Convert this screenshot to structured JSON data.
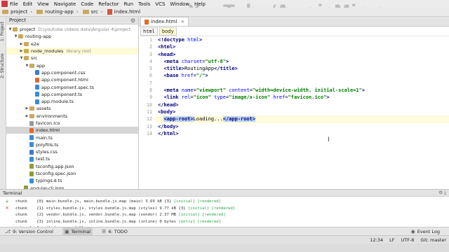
{
  "menubar": {
    "items": [
      "File",
      "Edit",
      "View",
      "Navigate",
      "Code",
      "Refactor",
      "Run",
      "Tools",
      "VCS",
      "Window",
      "Help"
    ]
  },
  "watermark": "YouTube/AwaisMirza",
  "navbar": {
    "crumbs": [
      "project",
      "routing-app",
      "src",
      "index.html"
    ]
  },
  "left_strip": {
    "tabs": [
      "1: Project",
      "2: Structure"
    ]
  },
  "project_panel": {
    "title": "Project",
    "tree": [
      {
        "label": "project",
        "suffix": "D:\\youtube videos data\\Angular 4\\project",
        "depth": 0,
        "kind": "folder",
        "open": true
      },
      {
        "label": "routing-app",
        "depth": 1,
        "kind": "folder",
        "open": true
      },
      {
        "label": "e2e",
        "depth": 2,
        "kind": "folder",
        "open": false
      },
      {
        "label": "node_modules",
        "suffix": "library root",
        "depth": 2,
        "kind": "folder",
        "open": false,
        "highlight": true
      },
      {
        "label": "src",
        "depth": 2,
        "kind": "folder",
        "open": true
      },
      {
        "label": "app",
        "depth": 3,
        "kind": "folder",
        "open": true
      },
      {
        "label": "app.component.css",
        "depth": 4,
        "kind": "css"
      },
      {
        "label": "app.component.html",
        "depth": 4,
        "kind": "html"
      },
      {
        "label": "app.component.spec.ts",
        "depth": 4,
        "kind": "ts"
      },
      {
        "label": "app.component.ts",
        "depth": 4,
        "kind": "ts"
      },
      {
        "label": "app.module.ts",
        "depth": 4,
        "kind": "ts"
      },
      {
        "label": "assets",
        "depth": 3,
        "kind": "folder",
        "open": false
      },
      {
        "label": "environments",
        "depth": 3,
        "kind": "folder",
        "open": false
      },
      {
        "label": "favicon.ico",
        "depth": 3,
        "kind": "ico-file"
      },
      {
        "label": "index.html",
        "depth": 3,
        "kind": "html",
        "selected": true
      },
      {
        "label": "main.ts",
        "depth": 3,
        "kind": "ts"
      },
      {
        "label": "polyfills.ts",
        "depth": 3,
        "kind": "ts"
      },
      {
        "label": "styles.css",
        "depth": 3,
        "kind": "css"
      },
      {
        "label": "test.ts",
        "depth": 3,
        "kind": "ts"
      },
      {
        "label": "tsconfig.app.json",
        "depth": 3,
        "kind": "json"
      },
      {
        "label": "tsconfig.spec.json",
        "depth": 3,
        "kind": "json"
      },
      {
        "label": "typings.d.ts",
        "depth": 3,
        "kind": "ts"
      },
      {
        "label": "angular-cli.json",
        "depth": 2,
        "kind": "json"
      }
    ]
  },
  "editor": {
    "tab": "index.html",
    "breadcrumb": [
      "html",
      "body"
    ],
    "lines": [
      [
        {
          "t": "<!doctype ",
          "c": "kw"
        },
        {
          "t": "html",
          "c": "attr"
        },
        {
          "t": ">",
          "c": "kw"
        }
      ],
      [
        {
          "t": "<html>",
          "c": "kw"
        }
      ],
      [
        {
          "t": "<head>",
          "c": "kw"
        }
      ],
      [
        {
          "t": "  "
        },
        {
          "t": "<meta ",
          "c": "kw"
        },
        {
          "t": "charset",
          "c": "attr"
        },
        {
          "t": "=",
          "c": ""
        },
        {
          "t": "\"utf-8\"",
          "c": "str"
        },
        {
          "t": ">",
          "c": "kw"
        }
      ],
      [
        {
          "t": "  "
        },
        {
          "t": "<title>",
          "c": "kw"
        },
        {
          "t": "RoutingApp"
        },
        {
          "t": "</title>",
          "c": "kw"
        }
      ],
      [
        {
          "t": "  "
        },
        {
          "t": "<base ",
          "c": "kw"
        },
        {
          "t": "href",
          "c": "attr"
        },
        {
          "t": "=",
          "c": ""
        },
        {
          "t": "\"/\"",
          "c": "str"
        },
        {
          "t": ">",
          "c": "kw"
        }
      ],
      [
        {
          "t": ""
        }
      ],
      [
        {
          "t": "  "
        },
        {
          "t": "<meta ",
          "c": "kw"
        },
        {
          "t": "name",
          "c": "attr"
        },
        {
          "t": "="
        },
        {
          "t": "\"viewport\"",
          "c": "str"
        },
        {
          "t": " "
        },
        {
          "t": "content",
          "c": "attr"
        },
        {
          "t": "="
        },
        {
          "t": "\"width=device-width, initial-scale=1\"",
          "c": "str"
        },
        {
          "t": ">",
          "c": "kw"
        }
      ],
      [
        {
          "t": "  "
        },
        {
          "t": "<link ",
          "c": "kw"
        },
        {
          "t": "rel",
          "c": "attr"
        },
        {
          "t": "="
        },
        {
          "t": "\"icon\"",
          "c": "str"
        },
        {
          "t": " "
        },
        {
          "t": "type",
          "c": "attr"
        },
        {
          "t": "="
        },
        {
          "t": "\"image/x-icon\"",
          "c": "str"
        },
        {
          "t": " "
        },
        {
          "t": "href",
          "c": "attr"
        },
        {
          "t": "="
        },
        {
          "t": "\"favicon.ico\"",
          "c": "str"
        },
        {
          "t": ">",
          "c": "kw"
        }
      ],
      [
        {
          "t": "</head>",
          "c": "kw"
        }
      ],
      [
        {
          "t": "<body>",
          "c": "kw"
        }
      ],
      [
        {
          "t": "  "
        },
        {
          "t": "<app-root>",
          "c": "kw sel"
        },
        {
          "t": "Loading..."
        },
        {
          "t": "</app-root>",
          "c": "kw sel"
        }
      ],
      [
        {
          "t": "</body>",
          "c": "kw"
        }
      ],
      [
        {
          "t": "</html>",
          "c": "kw"
        }
      ]
    ],
    "current_line": 12
  },
  "terminal": {
    "title": "Terminal",
    "lines": [
      [
        {
          "t": "chunk    {0} main.bundle.js, main.bundle.js.map (main) 3.69 kB {3} "
        },
        {
          "t": "[initial] [rendered]",
          "c": "g"
        }
      ],
      [
        {
          "t": "chunk    {1} styles.bundle.js, styles.bundle.js.map (styles) 9.77 kB {3} "
        },
        {
          "t": "[initial] [rendered]",
          "c": "g"
        }
      ],
      [
        {
          "t": "chunk    {2} vendor.bundle.js, vendor.bundle.js.map (vendor) 2.37 MB "
        },
        {
          "t": "[initial] [rendered]",
          "c": "g"
        }
      ],
      [
        {
          "t": "chunk    {3} inline.bundle.js, inline.bundle.js.map (inline) 0 bytes "
        },
        {
          "t": "[entry] [rendered]",
          "c": "g"
        }
      ],
      [
        {
          "t": "webpack: Compiled successfully."
        }
      ]
    ]
  },
  "bottom_tabs": [
    {
      "label": "9: Version Control",
      "icon": "version-control-icon"
    },
    {
      "label": "Terminal",
      "icon": "terminal-icon",
      "active": true
    },
    {
      "label": "6: TODO",
      "icon": "todo-icon"
    }
  ],
  "event_log": "Event Log",
  "status": {
    "position": "12:34",
    "line_sep": "LF",
    "encoding": "UTF-8",
    "vcs": "Git: master"
  }
}
